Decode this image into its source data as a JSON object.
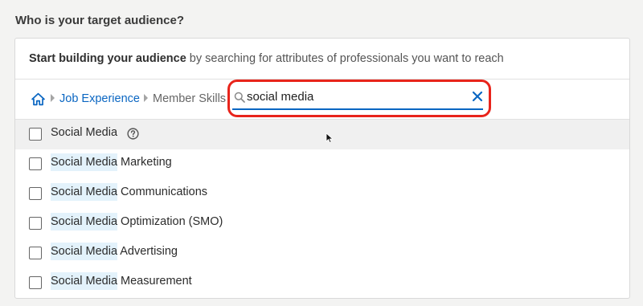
{
  "page": {
    "heading": "Who is your target audience?"
  },
  "intro": {
    "bold": "Start building your audience",
    "rest": " by searching for attributes of professionals you want to reach"
  },
  "breadcrumb": {
    "home_icon": "home-icon",
    "items": [
      {
        "label": "Job Experience"
      },
      {
        "label": "Member Skills"
      }
    ]
  },
  "search": {
    "value": "social media",
    "placeholder": "",
    "icon": "search-icon",
    "clear_icon": "close-icon"
  },
  "results": [
    {
      "match": "Social Media",
      "rest": "",
      "has_help": true
    },
    {
      "match": "Social Media",
      "rest": " Marketing"
    },
    {
      "match": "Social Media",
      "rest": " Communications"
    },
    {
      "match": "Social Media",
      "rest": " Optimization (SMO)"
    },
    {
      "match": "Social Media",
      "rest": " Advertising"
    },
    {
      "match": "Social Media",
      "rest": " Measurement"
    }
  ],
  "colors": {
    "accent": "#0a66c2",
    "highlight": "#e3f2fb",
    "annotation_ring": "#e8241b"
  }
}
